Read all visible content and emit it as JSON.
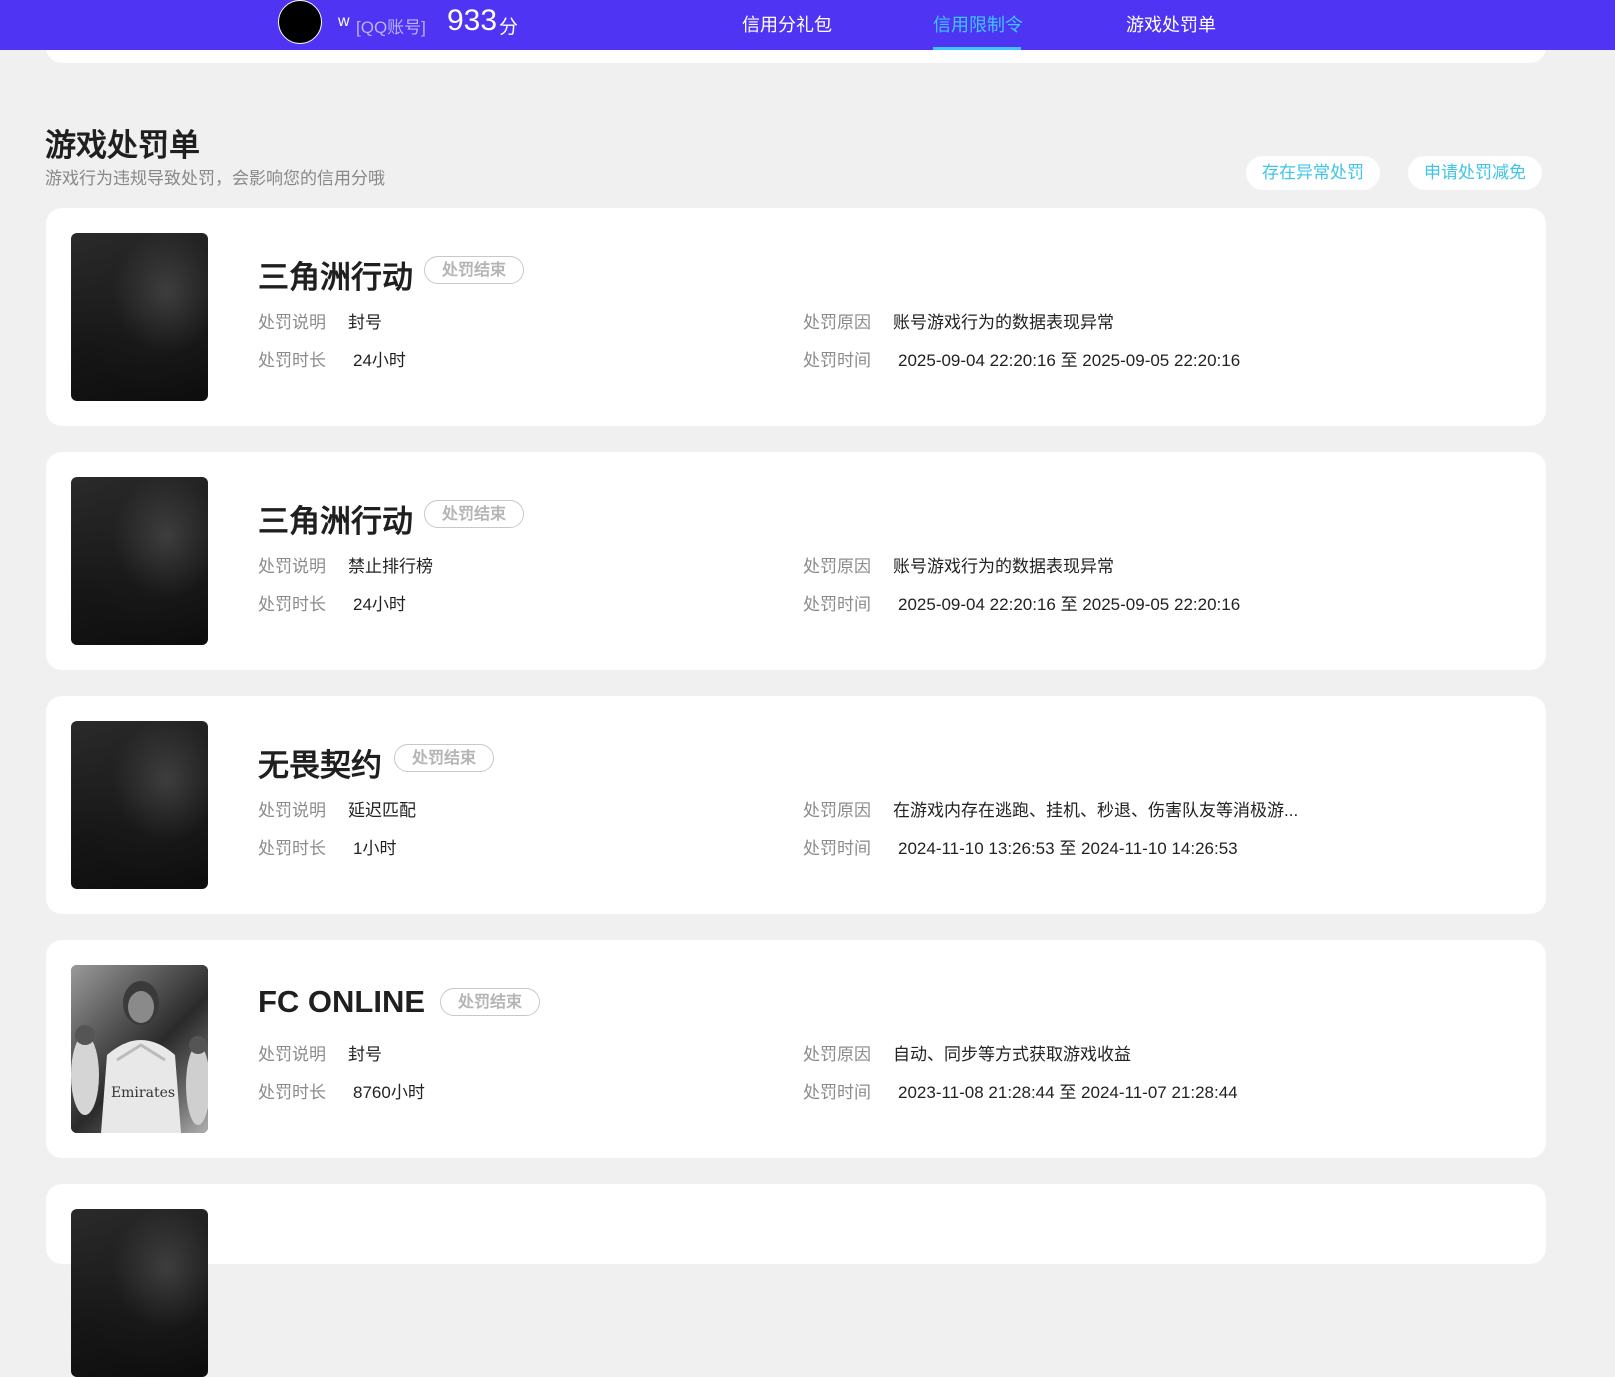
{
  "header": {
    "username": "w",
    "account_type": "[QQ账号]",
    "score": "933",
    "score_unit": "分",
    "tabs": [
      {
        "label": "信用分礼包",
        "active": false
      },
      {
        "label": "信用限制令",
        "active": true
      },
      {
        "label": "游戏处罚单",
        "active": false
      }
    ],
    "colors": {
      "bar": "#4f35f3",
      "active_tab": "#3ec5ff"
    }
  },
  "section": {
    "title": "游戏处罚单",
    "subtitle": "游戏行为违规导致处罚，会影响您的信用分哦",
    "actions": [
      "存在异常处罚",
      "申请处罚减免"
    ]
  },
  "labels": {
    "desc": "处罚说明",
    "duration": "处罚时长",
    "reason": "处罚原因",
    "time": "处罚时间"
  },
  "penalties": [
    {
      "game": "三角洲行动",
      "status": "处罚结束",
      "desc": "封号",
      "duration": "24小时",
      "reason": "账号游戏行为的数据表现异常",
      "time": "2025-09-04 22:20:16 至 2025-09-05 22:20:16",
      "thumb": "dark-game-cover"
    },
    {
      "game": "三角洲行动",
      "status": "处罚结束",
      "desc": "禁止排行榜",
      "duration": "24小时",
      "reason": "账号游戏行为的数据表现异常",
      "time": "2025-09-04 22:20:16 至 2025-09-05 22:20:16",
      "thumb": "dark-game-cover"
    },
    {
      "game": "无畏契约",
      "status": "处罚结束",
      "desc": "延迟匹配",
      "duration": "1小时",
      "reason": "在游戏内存在逃跑、挂机、秒退、伤害队友等消极游...",
      "time": "2024-11-10 13:26:53 至 2024-11-10 14:26:53",
      "thumb": "dark-game-cover"
    },
    {
      "game": "FC ONLINE",
      "status": "处罚结束",
      "desc": "封号",
      "duration": "8760小时",
      "reason": "自动、同步等方式获取游戏收益",
      "time": "2023-11-08 21:28:44 至 2024-11-07 21:28:44",
      "thumb": "football-player-cover",
      "thumb_text": "Emirates"
    }
  ]
}
